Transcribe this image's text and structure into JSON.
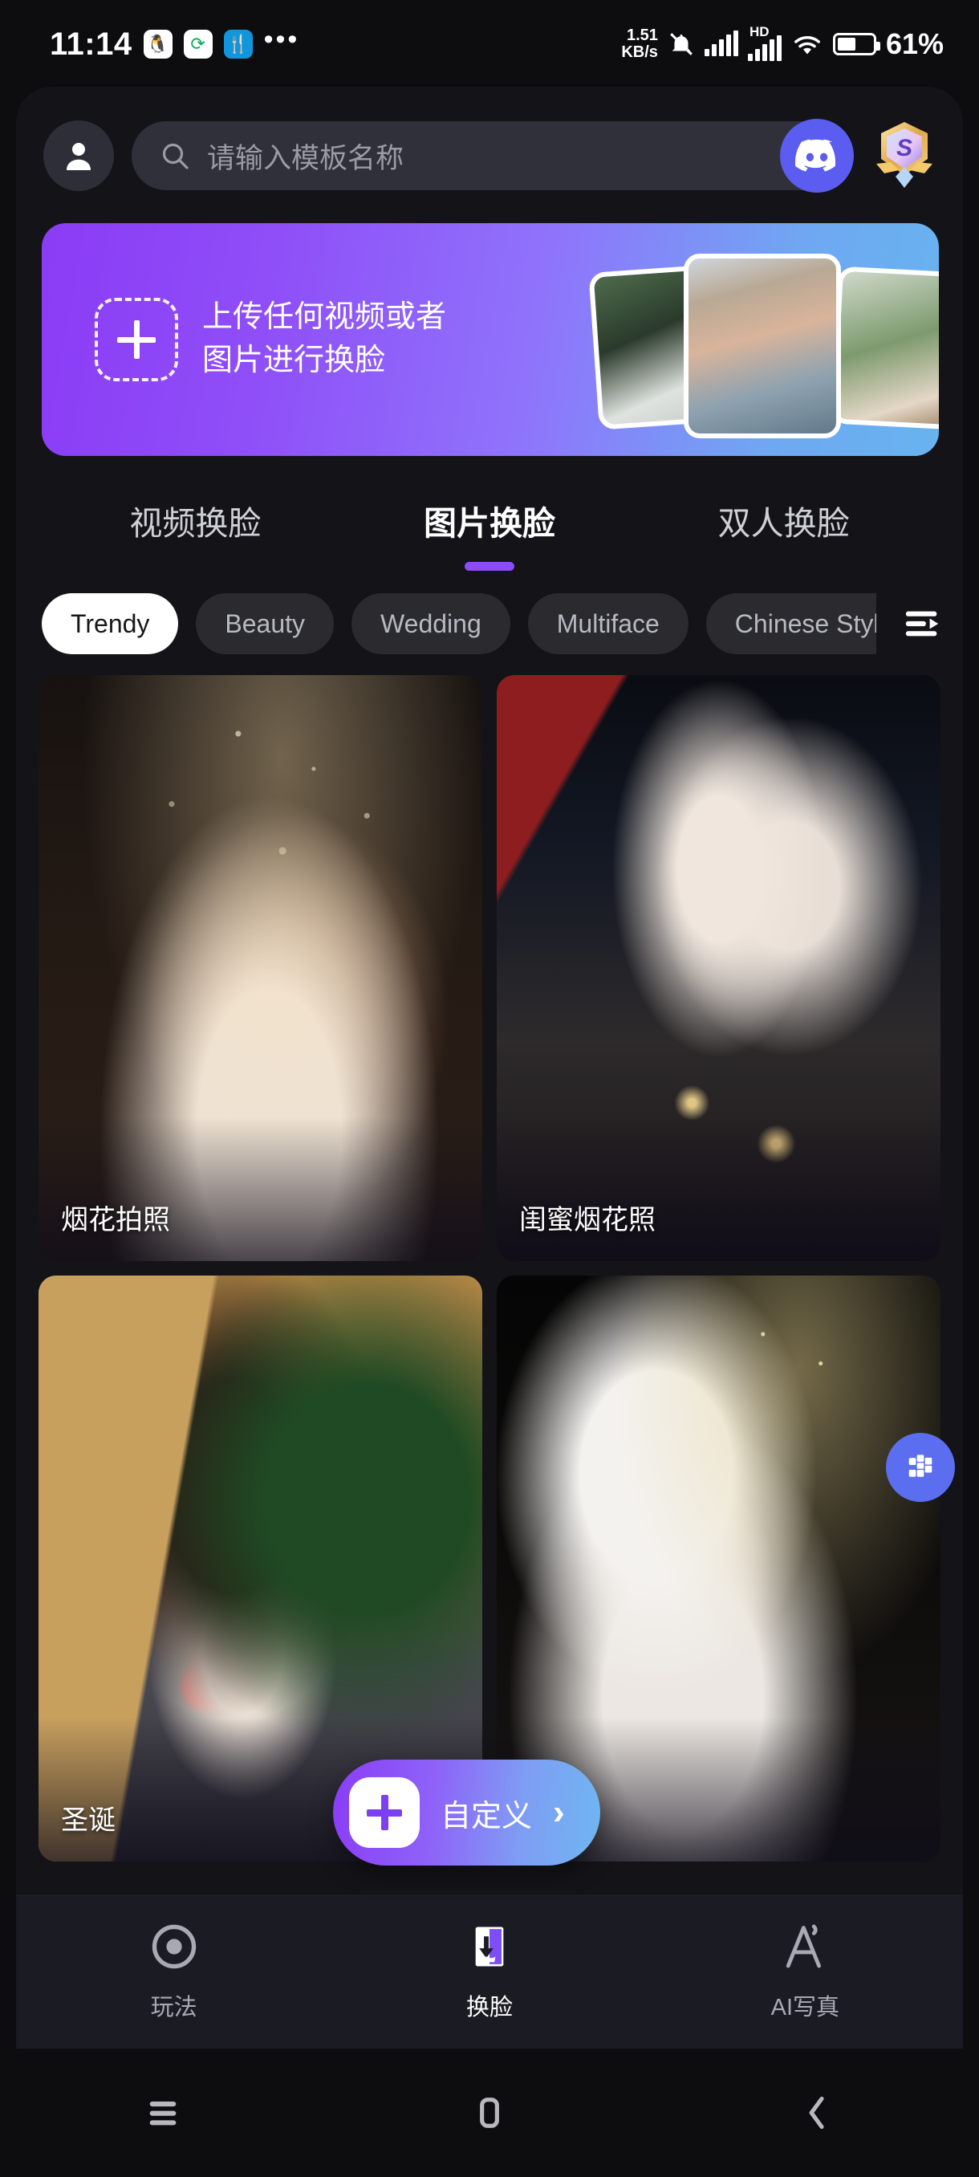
{
  "status_bar": {
    "time": "11:14",
    "app_icons": [
      "qq-icon",
      "wechat-sync-icon",
      "android-app-icon"
    ],
    "overflow": "•••",
    "network_speed_value": "1.51",
    "network_speed_unit": "KB/s",
    "mute_icon": "bell-muted-icon",
    "signal_icon": "signal-bars-icon",
    "hd_label": "HD",
    "hd_signal_icon": "hd-signal-bars-icon",
    "wifi_icon": "wifi-icon",
    "battery_icon": "battery-icon",
    "battery_percent": "61%"
  },
  "header": {
    "avatar": "user-avatar-icon",
    "search": {
      "icon": "search-icon",
      "placeholder": "请输入模板名称",
      "value": ""
    },
    "discord_button": "discord-icon",
    "level_badge": "level-badge-icon",
    "level_badge_letter": "S"
  },
  "banner": {
    "upload_icon": "plus-dashed-box-icon",
    "text": "上传任何视频或者图片进行换脸",
    "accent_start": "#8b3bf5",
    "accent_end": "#67b4ef",
    "thumbnails": [
      "thumb-left",
      "thumb-center",
      "thumb-right"
    ]
  },
  "tabs": {
    "active_index": 1,
    "items": [
      {
        "label": "视频换脸"
      },
      {
        "label": "图片换脸"
      },
      {
        "label": "双人换脸"
      }
    ],
    "underline_color": "#8c4cf5"
  },
  "categories": {
    "active_index": 0,
    "items": [
      {
        "label": "Trendy"
      },
      {
        "label": "Beauty"
      },
      {
        "label": "Wedding"
      },
      {
        "label": "Multiface"
      },
      {
        "label": "Chinese Style"
      }
    ],
    "filter_icon": "filter-list-icon"
  },
  "templates": [
    {
      "name": "烟花拍照",
      "art": "art1"
    },
    {
      "name": "闺蜜烟花照",
      "art": "art2"
    },
    {
      "name": "圣诞",
      "art": "art3"
    },
    {
      "name": "",
      "art": "art4"
    }
  ],
  "floating": {
    "cube_button": "cube-3d-icon",
    "custom_button": {
      "plus_icon": "plus-icon",
      "label": "自定义",
      "chevron": "›",
      "gradient_start": "#8a3df6",
      "gradient_end": "#6fb6f1"
    }
  },
  "bottom_nav": {
    "active_index": 1,
    "items": [
      {
        "label": "玩法",
        "icon": "record-circle-icon"
      },
      {
        "label": "换脸",
        "icon": "face-swap-icon"
      },
      {
        "label": "AI写真",
        "icon": "ai-portrait-icon"
      }
    ]
  },
  "android_nav": {
    "items": [
      {
        "icon": "recents-menu-icon"
      },
      {
        "icon": "home-square-icon"
      },
      {
        "icon": "back-chevron-icon"
      }
    ]
  }
}
